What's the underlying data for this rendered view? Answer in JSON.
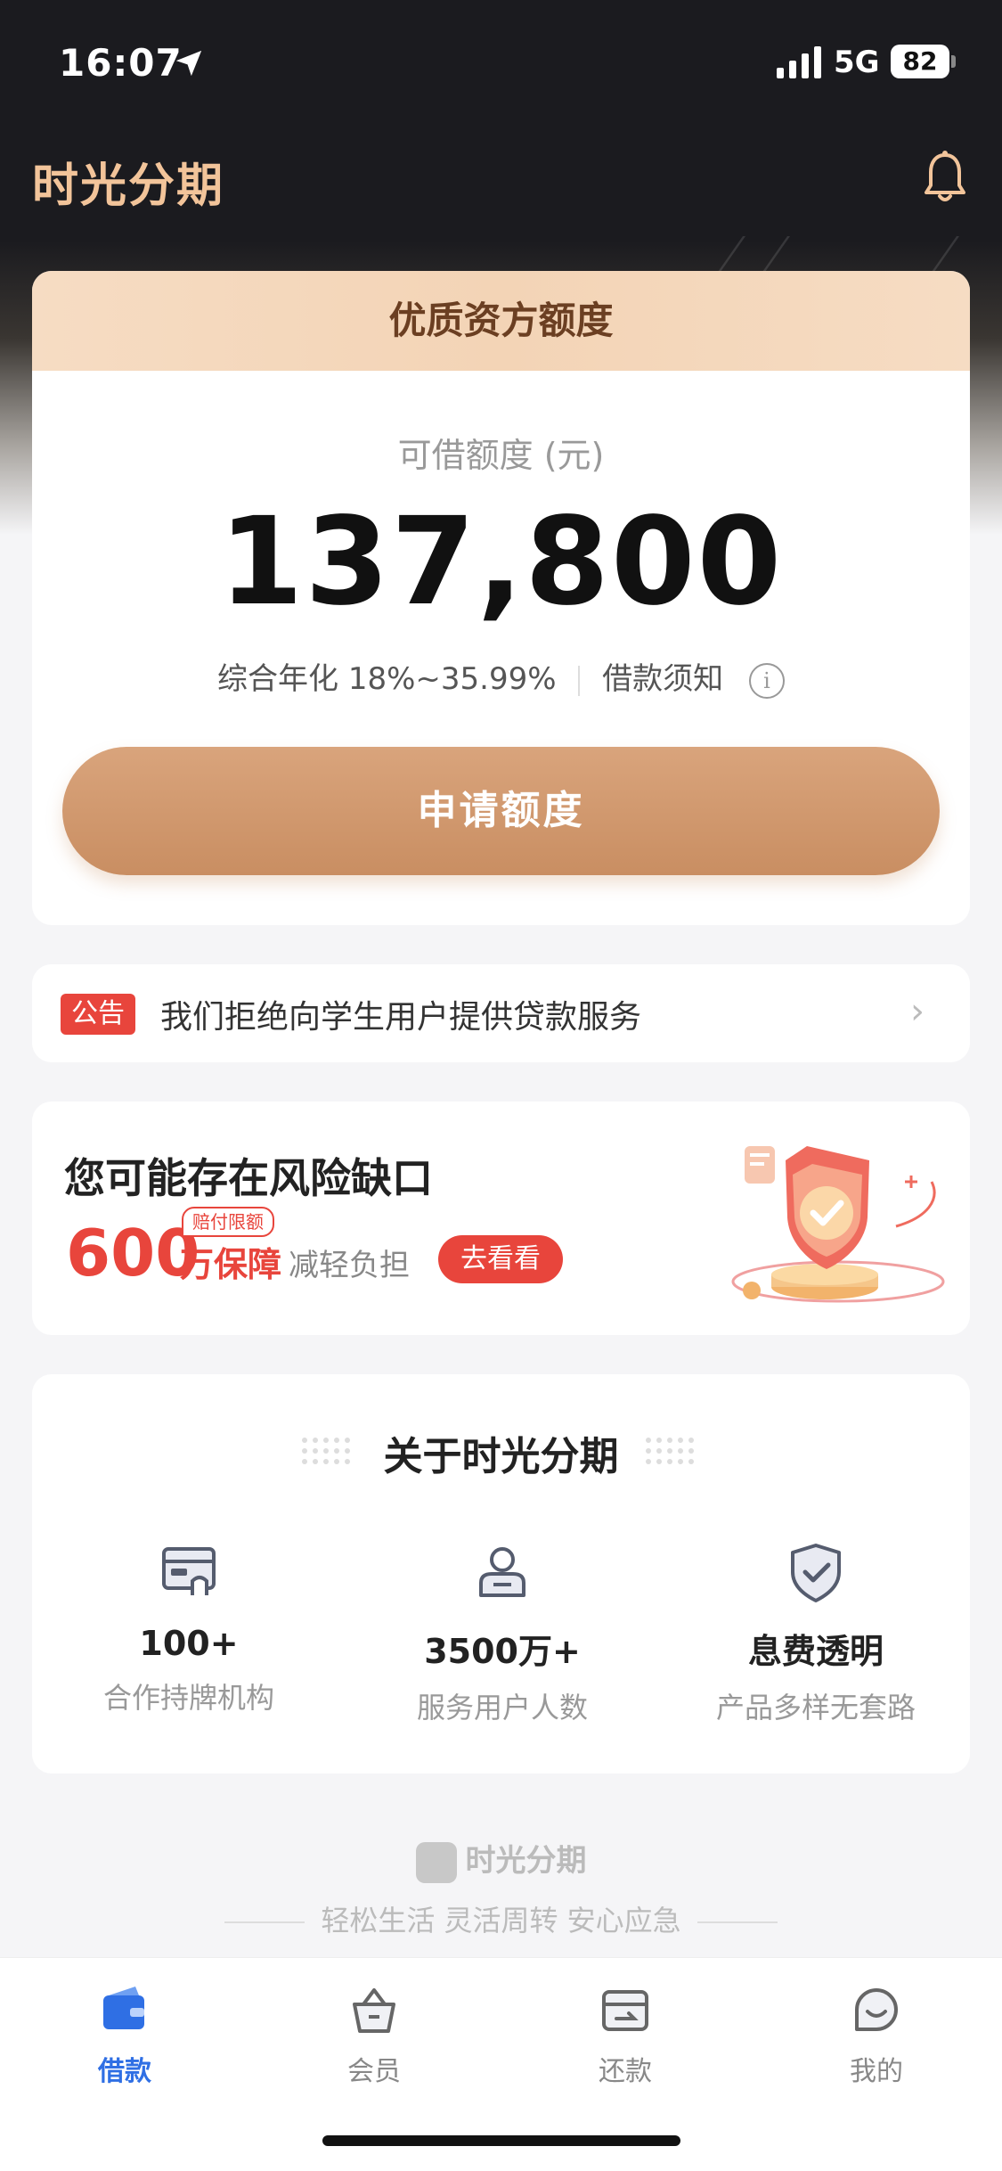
{
  "status": {
    "time": "16:07",
    "network": "5G",
    "battery": "82"
  },
  "header": {
    "app_name": "时光分期"
  },
  "credit": {
    "header": "优质资方额度",
    "subtitle": "可借额度 (元)",
    "amount": "137,800",
    "rate": "综合年化 18%~35.99%",
    "notice_link": "借款须知",
    "apply_label": "申请额度"
  },
  "notice": {
    "tag": "公告",
    "text": "我们拒绝向学生用户提供贷款服务"
  },
  "risk": {
    "title": "您可能存在风险缺口",
    "amount": "600",
    "unit": "万保障",
    "badge": "赔付限额",
    "reduce": "减轻负担",
    "button": "去看看"
  },
  "about": {
    "title": "关于时光分期",
    "stats": [
      {
        "value": "100+",
        "label": "合作持牌机构",
        "icon": "card-icon"
      },
      {
        "value": "3500万+",
        "label": "服务用户人数",
        "icon": "user-icon"
      },
      {
        "value": "息费透明",
        "label": "产品多样无套路",
        "icon": "shield-check-icon"
      }
    ]
  },
  "footer": {
    "brand": "时光分期",
    "slogan": "轻松生活 灵活周转 安心应急"
  },
  "tabs": [
    {
      "label": "借款",
      "icon": "wallet-icon",
      "active": true
    },
    {
      "label": "会员",
      "icon": "basket-icon",
      "active": false
    },
    {
      "label": "还款",
      "icon": "repay-icon",
      "active": false
    },
    {
      "label": "我的",
      "icon": "smile-icon",
      "active": false
    }
  ],
  "colors": {
    "accent": "#c98e62",
    "alert": "#e8453c",
    "tab_active": "#2f6fe4",
    "logo": "#f2c49a"
  }
}
